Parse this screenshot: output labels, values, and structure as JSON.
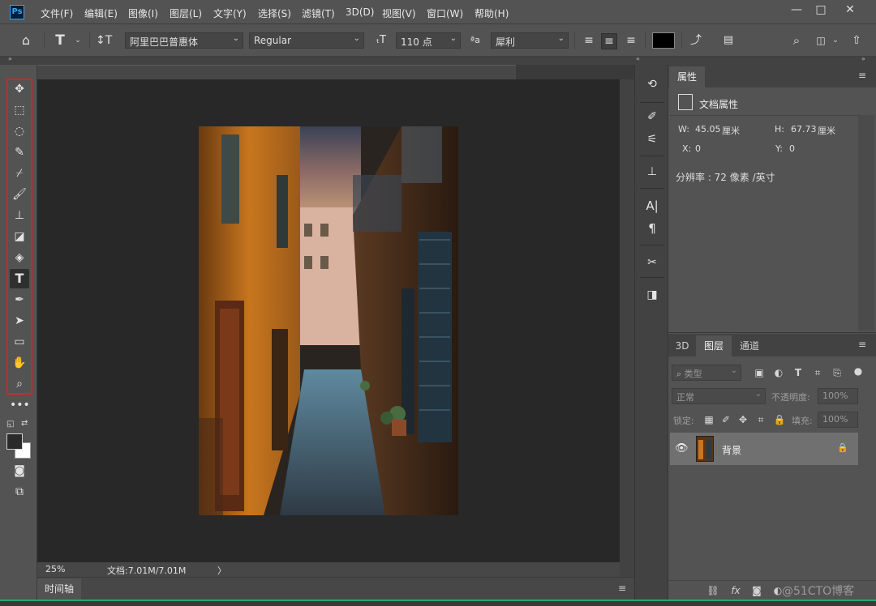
{
  "app": {
    "logo": "Ps"
  },
  "menu": [
    "文件(F)",
    "编辑(E)",
    "图像(I)",
    "图层(L)",
    "文字(Y)",
    "选择(S)",
    "滤镜(T)",
    "3D(D)",
    "视图(V)",
    "窗口(W)",
    "帮助(H)"
  ],
  "window_controls": {
    "minimize": "—",
    "maximize": "□",
    "close": "✕"
  },
  "options": {
    "font_family": "阿里巴巴普惠体",
    "font_style": "Regular",
    "font_size": "110 点",
    "antialias_label": "ªa",
    "antialias": "犀利",
    "color": "#000000"
  },
  "status": {
    "zoom": "25%",
    "doc": "文档:7.01M/7.01M",
    "arrow": "〉"
  },
  "timeline": {
    "label": "时间轴"
  },
  "properties": {
    "tab": "属性",
    "title": "文档属性",
    "w_label": "W:",
    "w_value": "45.05",
    "w_unit": "厘米",
    "h_label": "H:",
    "h_value": "67.73",
    "h_unit": "厘米",
    "x_label": "X:",
    "x_value": "0",
    "y_label": "Y:",
    "y_value": "0",
    "resolution": "分辨率 : 72 像素 /英寸"
  },
  "layers_panel": {
    "tabs": [
      "3D",
      "图层",
      "通道"
    ],
    "filter_kind": "类型",
    "blend_mode": "正常",
    "opacity_label": "不透明度:",
    "opacity_value": "100%",
    "lock_label": "锁定:",
    "fill_label": "填充:",
    "fill_value": "100%",
    "layer_name": "背景"
  },
  "watermark": "@51CTO博客",
  "colors": {
    "highlight": "#e0201b",
    "accent": "#31a8ff",
    "foreground": "#2a2a2a",
    "background": "#ffffff"
  }
}
